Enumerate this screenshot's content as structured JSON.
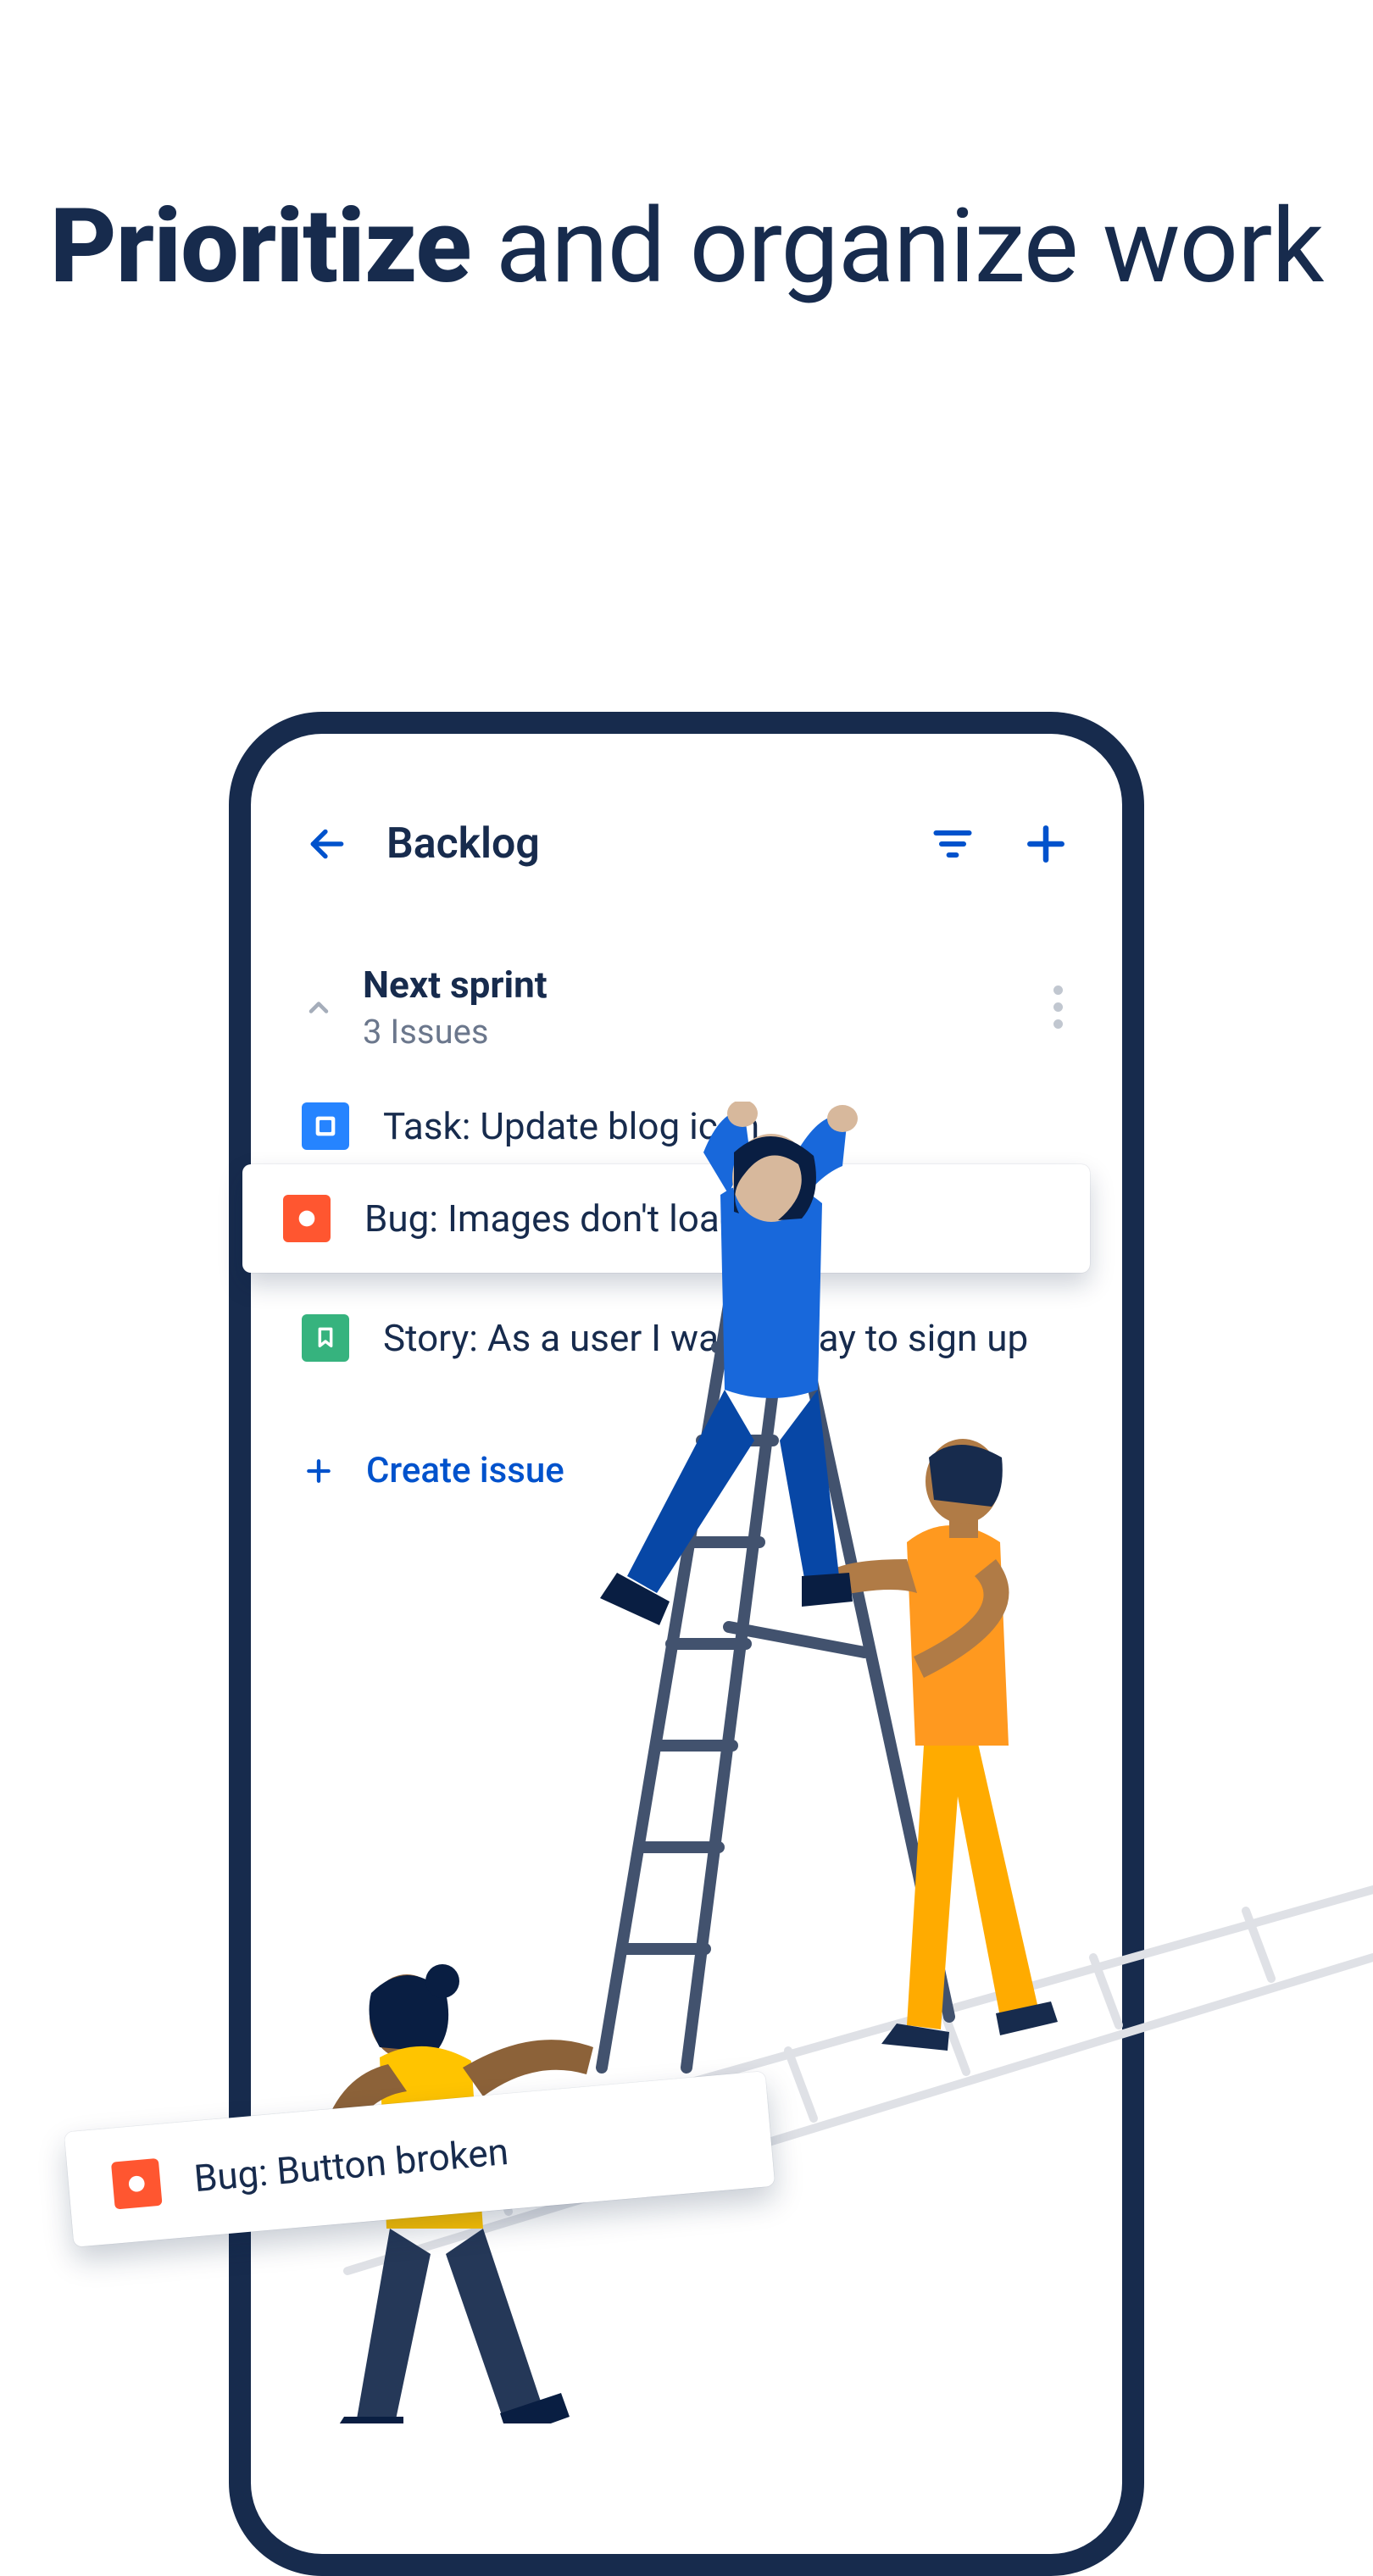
{
  "headline": {
    "bold_word": "Prioritize",
    "rest": " and organize work"
  },
  "app": {
    "title": "Backlog"
  },
  "section": {
    "title": "Next sprint",
    "subtitle": "3 Issues"
  },
  "issues": {
    "task": "Task: Update blog icon",
    "bug1": "Bug: Images don't load",
    "story": "Story: As a user I want a way to sign up",
    "bug2": "Bug: Button broken"
  },
  "actions": {
    "create_issue": "Create issue"
  },
  "icons": {
    "back": "back-arrow",
    "filter": "filter",
    "add": "plus",
    "more": "more-vertical",
    "collapse": "chevron-up"
  },
  "colors": {
    "primary_text": "#172B4D",
    "secondary_text": "#6B778C",
    "brand_blue": "#0052CC",
    "task": "#2684FF",
    "bug": "#FF5630",
    "story": "#36B37E",
    "person_blue": "#1868DB",
    "person_orange": "#FFAB00",
    "ladder": "#42526E"
  }
}
